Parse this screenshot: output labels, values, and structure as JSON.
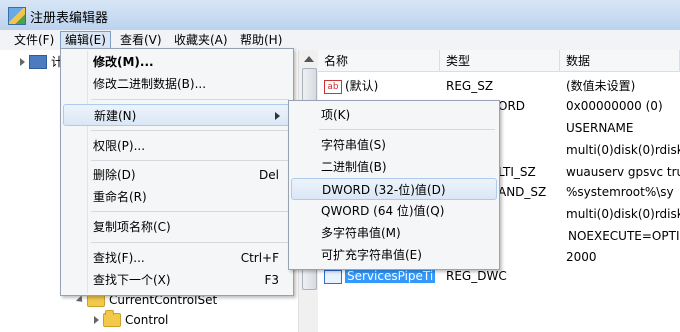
{
  "window": {
    "title": "注册表编辑器"
  },
  "menubar": [
    "文件(F)",
    "编辑(E)",
    "查看(V)",
    "收藏夹(A)",
    "帮助(H)"
  ],
  "tree": {
    "root_label": "计",
    "items": [
      {
        "label": "CurrentControlSet"
      },
      {
        "label": "Control"
      }
    ]
  },
  "columns": {
    "name": "名称",
    "type": "类型",
    "data": "数据"
  },
  "values": [
    {
      "name": "(默认)",
      "type": "REG_SZ",
      "data": "(数值未设置)"
    },
    {
      "name": "",
      "type": "ORD",
      "data": "0x00000000 (0)"
    },
    {
      "name": "",
      "type": "",
      "data": "USERNAME"
    },
    {
      "name": "",
      "type": "",
      "data": "multi(0)disk(0)rdisk"
    },
    {
      "name": "",
      "type": "LTI_SZ",
      "data": "wuauserv gpsvc tru"
    },
    {
      "name": "",
      "type": "AND_SZ",
      "data": "%systemroot%\\sy"
    },
    {
      "name": "",
      "type": "",
      "data": "multi(0)disk(0)rdisk"
    },
    {
      "name": "",
      "type": "",
      "data": "NOEXECUTE=OPTI"
    },
    {
      "name": "",
      "type": "",
      "data": "2000"
    },
    {
      "name": "ServicesPipeTi",
      "type": "REG_DWC",
      "data": ""
    }
  ],
  "edit_menu": {
    "items": [
      {
        "label": "修改(M)...",
        "shortcut": ""
      },
      {
        "label": "修改二进制数据(B)...",
        "shortcut": ""
      },
      {
        "label": "新建(N)",
        "shortcut": ""
      },
      {
        "label": "权限(P)...",
        "shortcut": ""
      },
      {
        "label": "删除(D)",
        "shortcut": "Del"
      },
      {
        "label": "重命名(R)",
        "shortcut": ""
      },
      {
        "label": "复制项名称(C)",
        "shortcut": ""
      },
      {
        "label": "查找(F)...",
        "shortcut": "Ctrl+F"
      },
      {
        "label": "查找下一个(X)",
        "shortcut": "F3"
      }
    ]
  },
  "new_submenu": {
    "items": [
      "项(K)",
      "字符串值(S)",
      "二进制值(B)",
      "DWORD (32-位)值(D)",
      "QWORD (64 位)值(Q)",
      "多字符串值(M)",
      "可扩充字符串值(E)"
    ]
  }
}
